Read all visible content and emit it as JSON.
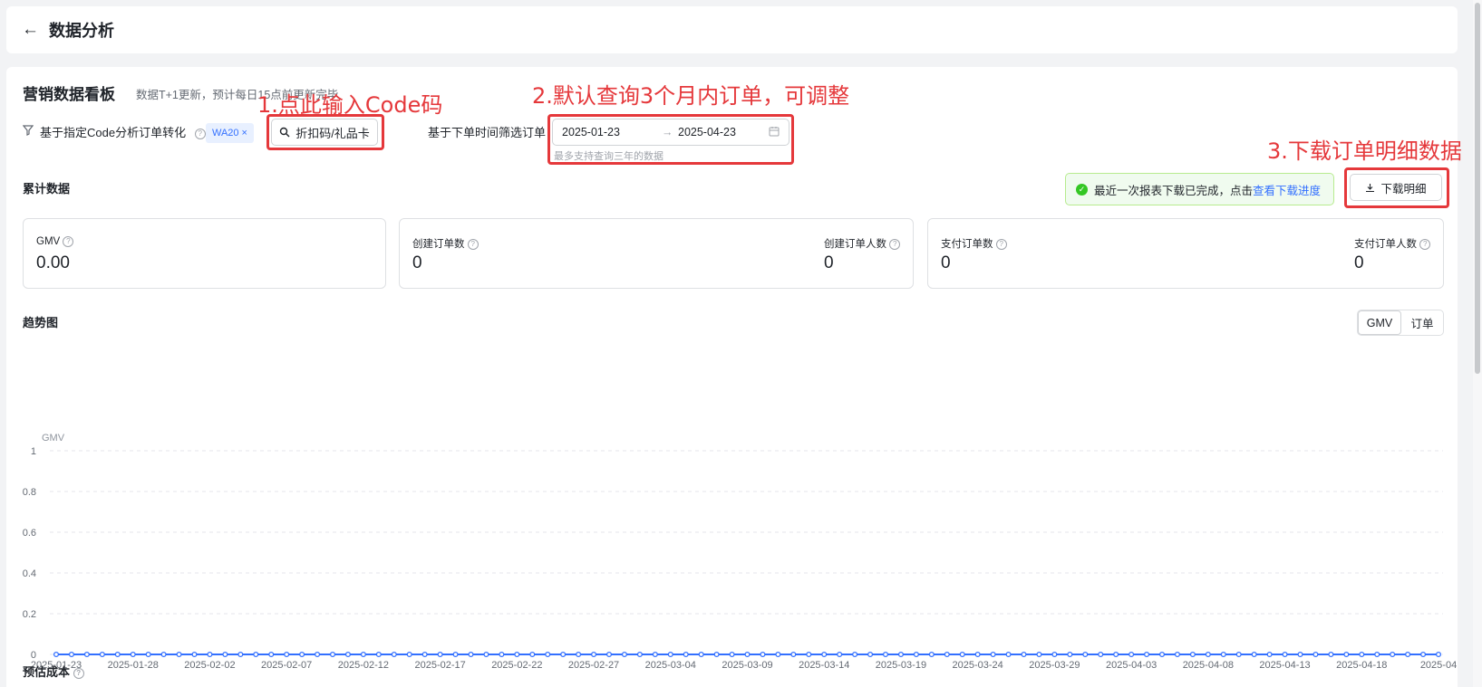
{
  "header": {
    "back_icon": "←",
    "title": "数据分析"
  },
  "board": {
    "title": "营销数据看板",
    "subtitle": "数据T+1更新，预计每日15点前更新完毕"
  },
  "filter": {
    "icon": "filter-icon",
    "label": "基于指定Code分析订单转化",
    "tag": "WA20",
    "code_button": "折扣码/礼品卡",
    "date_label": "基于下单时间筛选订单",
    "date_start": "2025-01-23",
    "date_end": "2025-04-23",
    "date_hint": "最多支持查询三年的数据"
  },
  "annotations": {
    "a1": "1.点此输入Code码",
    "a2": "2.默认查询3个月内订单，可调整",
    "a3": "3.下载订单明细数据",
    "color": "#e5383b"
  },
  "cumulative": {
    "title": "累计数据",
    "notice_text": "最近一次报表下载已完成，点击",
    "notice_link": "查看下载进度",
    "download_button": "下载明细",
    "metrics": {
      "gmv": {
        "label": "GMV",
        "value": "0.00"
      },
      "created_orders": {
        "label": "创建订单数",
        "value": "0"
      },
      "created_users": {
        "label": "创建订单人数",
        "value": "0"
      },
      "paid_orders": {
        "label": "支付订单数",
        "value": "0"
      },
      "paid_users": {
        "label": "支付订单人数",
        "value": "0"
      }
    }
  },
  "trend": {
    "title": "趋势图",
    "tabs": [
      "GMV",
      "订单"
    ],
    "active_tab": "GMV"
  },
  "cost": {
    "title": "预估成本"
  },
  "chart_data": {
    "type": "line",
    "ylabel": "GMV",
    "ylim": [
      0,
      1
    ],
    "yticks": [
      "1",
      "0.8",
      "0.6",
      "0.4",
      "0.2",
      "0"
    ],
    "x_start": "2025-01-23",
    "x_end": "2025-04-23",
    "xtick_labels": [
      "2025-01-23",
      "2025-01-28",
      "2025-02-02",
      "2025-02-07",
      "2025-02-12",
      "2025-02-17",
      "2025-02-22",
      "2025-02-27",
      "2025-03-04",
      "2025-03-09",
      "2025-03-14",
      "2025-03-19",
      "2025-03-24",
      "2025-03-29",
      "2025-04-03",
      "2025-04-08",
      "2025-04-13",
      "2025-04-18",
      "2025-04"
    ],
    "series": [
      {
        "values_all": 0
      }
    ],
    "grid": true,
    "color": "#3370ff"
  }
}
